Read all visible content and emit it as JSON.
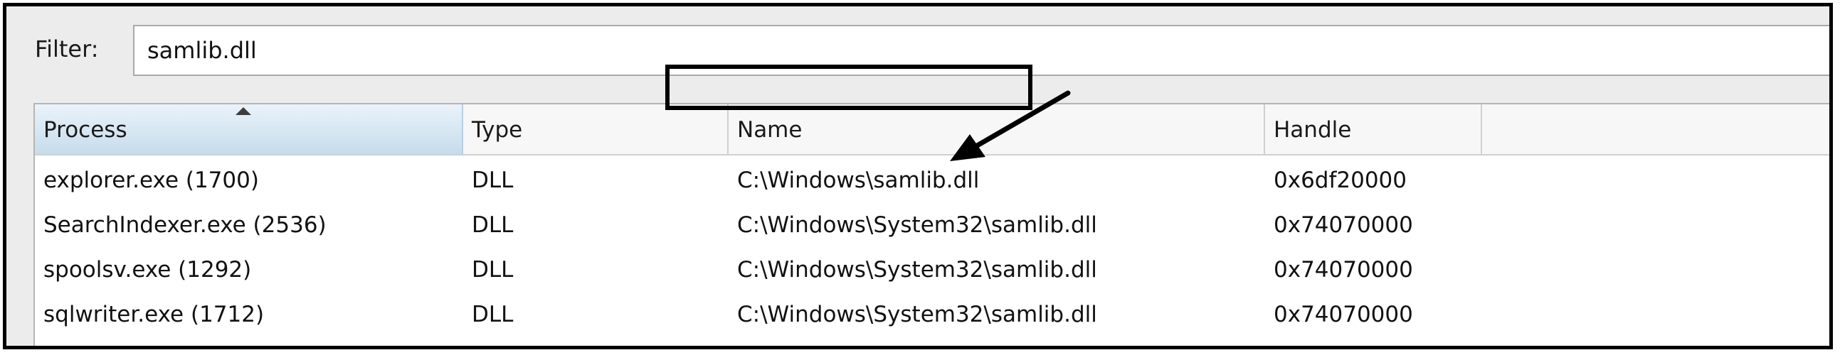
{
  "filter": {
    "label": "Filter:",
    "value": "samlib.dll"
  },
  "columns": [
    {
      "label": "Process",
      "sorted": true
    },
    {
      "label": "Type"
    },
    {
      "label": "Name"
    },
    {
      "label": "Handle"
    },
    {
      "label": ""
    }
  ],
  "rows": [
    {
      "process": "explorer.exe (1700)",
      "type": "DLL",
      "name": "C:\\Windows\\samlib.dll",
      "handle": "0x6df20000"
    },
    {
      "process": "SearchIndexer.exe (2536)",
      "type": "DLL",
      "name": "C:\\Windows\\System32\\samlib.dll",
      "handle": "0x74070000"
    },
    {
      "process": "spoolsv.exe (1292)",
      "type": "DLL",
      "name": "C:\\Windows\\System32\\samlib.dll",
      "handle": "0x74070000"
    },
    {
      "process": "sqlwriter.exe (1712)",
      "type": "DLL",
      "name": "C:\\Windows\\System32\\samlib.dll",
      "handle": "0x74070000"
    }
  ],
  "annotation": {
    "highlight_color": "#000000",
    "icon": "arrow-icon"
  }
}
